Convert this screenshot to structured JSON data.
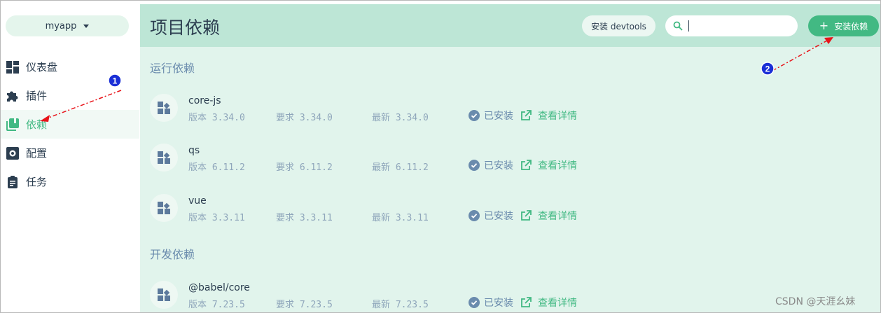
{
  "sidebar": {
    "project": "myapp",
    "items": [
      {
        "label": "仪表盘",
        "icon": "dashboard-icon"
      },
      {
        "label": "插件",
        "icon": "puzzle-icon"
      },
      {
        "label": "依赖",
        "icon": "library-books-icon",
        "active": true
      },
      {
        "label": "配置",
        "icon": "settings-icon"
      },
      {
        "label": "任务",
        "icon": "clipboard-icon"
      }
    ]
  },
  "header": {
    "title": "项目依赖",
    "devtools_label": "安装 devtools",
    "search_placeholder": "",
    "search_value": "",
    "install_label": "安装依赖"
  },
  "sections": {
    "runtime_title": "运行依赖",
    "dev_title": "开发依赖"
  },
  "dependencies": [
    {
      "name": "core-js",
      "version": "版本 3.34.0",
      "wanted": "要求 3.34.0",
      "latest": "最新 3.34.0",
      "status": "已安装",
      "detail": "查看详情"
    },
    {
      "name": "qs",
      "version": "版本 6.11.2",
      "wanted": "要求 6.11.2",
      "latest": "最新 6.11.2",
      "status": "已安装",
      "detail": "查看详情"
    },
    {
      "name": "vue",
      "version": "版本 3.3.11",
      "wanted": "要求 3.3.11",
      "latest": "最新 3.3.11",
      "status": "已安装",
      "detail": "查看详情"
    }
  ],
  "dev_dependencies": [
    {
      "name": "@babel/core",
      "version": "版本 7.23.5",
      "wanted": "要求 7.23.5",
      "latest": "最新 7.23.5",
      "status": "已安装",
      "detail": "查看详情"
    }
  ],
  "annotations": {
    "marker_1": "1",
    "marker_2": "2"
  },
  "watermark": "CSDN @天涯幺妹",
  "colors": {
    "accent": "#42b983",
    "header_bg": "#bde6d6",
    "content_bg": "#e1f4ec",
    "annotation_red": "#e8141a",
    "marker_blue": "#1a2fd6"
  }
}
